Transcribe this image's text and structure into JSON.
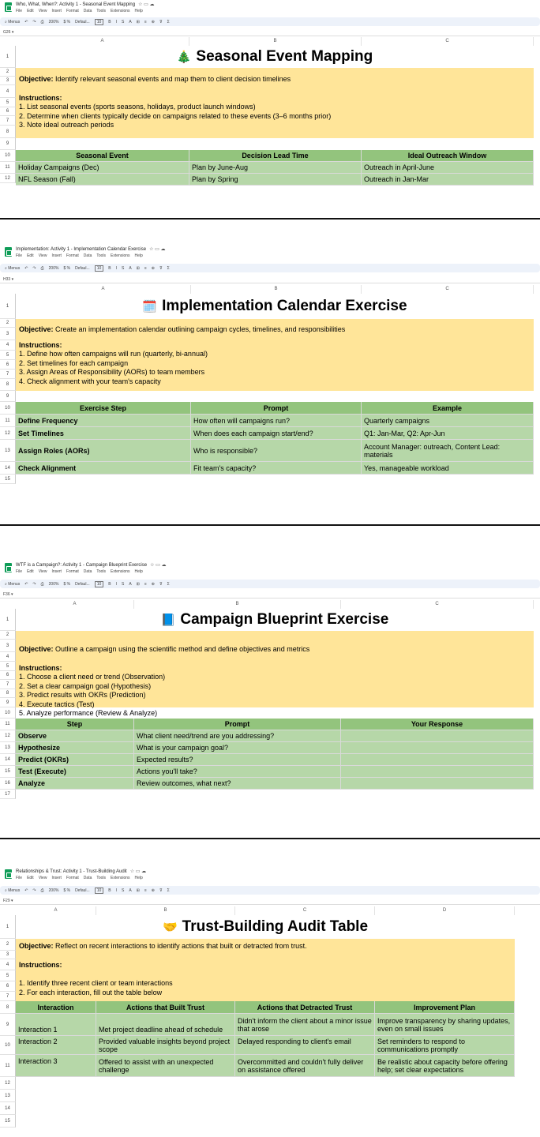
{
  "panels": [
    {
      "doc_title": "Who, What, When?: Activity 1 - Seasonal Event Mapping",
      "menus": [
        "File",
        "Edit",
        "View",
        "Insert",
        "Format",
        "Data",
        "Tools",
        "Extensions",
        "Help"
      ],
      "toolbar": {
        "menus": "Menus",
        "zoom": "200%",
        "font": "Defaul...",
        "size": "10"
      },
      "cell_ref": "G26",
      "columns": [
        "A",
        "B",
        "C"
      ],
      "rows": [
        "1",
        "2",
        "3",
        "4",
        "5",
        "6",
        "7",
        "8",
        "9",
        "10",
        "11",
        "12"
      ],
      "title_emoji": "🎄",
      "title": "Seasonal Event Mapping",
      "objective_label": "Objective:",
      "objective": " Identify relevant seasonal events and map them to client decision timelines",
      "instructions_label": "Instructions:",
      "instructions": [
        "1. List seasonal events (sports seasons, holidays, product launch windows)",
        "2. Determine when clients typically decide on campaigns related to these events (3–6 months prior)",
        "3. Note ideal outreach periods"
      ],
      "table_headers": [
        "Seasonal Event",
        "Decision Lead Time",
        "Ideal Outreach Window"
      ],
      "table_rows": [
        [
          "Holiday Campaigns (Dec)",
          "Plan by June-Aug",
          "Outreach in April-June"
        ],
        [
          "NFL Season (Fall)",
          "Plan by Spring",
          "Outreach in Jan-Mar"
        ]
      ]
    },
    {
      "doc_title": "Implementation: Activity 1 - Implementation Calendar Exercise",
      "menus": [
        "File",
        "Edit",
        "View",
        "Insert",
        "Format",
        "Data",
        "Tools",
        "Extensions",
        "Help"
      ],
      "toolbar": {
        "menus": "Menus",
        "zoom": "200%",
        "font": "Defaul...",
        "size": "10"
      },
      "cell_ref": "H33",
      "columns": [
        "A",
        "B",
        "C"
      ],
      "rows": [
        "1",
        "2",
        "3",
        "4",
        "5",
        "6",
        "7",
        "8",
        "9",
        "10",
        "11",
        "12",
        "13",
        "14",
        "15"
      ],
      "title_emoji": "🗓️",
      "title": "Implementation Calendar Exercise",
      "objective_label": "Objective:",
      "objective": " Create an implementation calendar outlining campaign cycles, timelines, and responsibilities",
      "instructions_label": "Instructions:",
      "instructions": [
        "1. Define how often campaigns will run (quarterly, bi-annual)",
        "2. Set timelines for each campaign",
        "3. Assign Areas of Responsibility (AORs) to team members",
        "4. Check alignment with your team's capacity"
      ],
      "table_headers": [
        "Exercise Step",
        "Prompt",
        "Example"
      ],
      "table_rows": [
        [
          "Define Frequency",
          "How often will campaigns run?",
          "Quarterly campaigns"
        ],
        [
          "Set Timelines",
          "When does each campaign start/end?",
          "Q1: Jan-Mar, Q2: Apr-Jun"
        ],
        [
          "Assign Roles (AORs)",
          "Who is responsible?",
          "Account Manager: outreach, Content Lead: materials"
        ],
        [
          "Check Alignment",
          "Fit team's capacity?",
          "Yes, manageable workload"
        ]
      ]
    },
    {
      "doc_title": "WTF is a Campaign?: Activity 1 - Campaign Blueprint Exercise",
      "menus": [
        "File",
        "Edit",
        "View",
        "Insert",
        "Format",
        "Data",
        "Tools",
        "Extensions",
        "Help"
      ],
      "toolbar": {
        "menus": "Menus",
        "zoom": "200%",
        "font": "Defaul...",
        "size": "10"
      },
      "cell_ref": "F36",
      "columns": [
        "A",
        "B",
        "C"
      ],
      "rows": [
        "1",
        "2",
        "3",
        "4",
        "5",
        "6",
        "7",
        "8",
        "9",
        "10",
        "11",
        "12",
        "13",
        "14",
        "15",
        "16",
        "17"
      ],
      "title_emoji": "📘",
      "title": "Campaign Blueprint Exercise",
      "objective_label": "Objective:",
      "objective": " Outline a campaign using the scientific method and define objectives and metrics",
      "instructions_label": "Instructions:",
      "instructions": [
        "1. Choose a client need or trend (Observation)",
        "2. Set a clear campaign goal (Hypothesis)",
        "3. Predict results with OKRs (Prediction)",
        "4. Execute tactics (Test)",
        "5. Analyze performance (Review & Analyze)"
      ],
      "table_headers": [
        "Step",
        "Prompt",
        "Your Response"
      ],
      "table_rows": [
        [
          "Observe",
          "What client need/trend are you addressing?",
          ""
        ],
        [
          "Hypothesize",
          "What is your campaign goal?",
          ""
        ],
        [
          "Predict (OKRs)",
          "Expected results?",
          ""
        ],
        [
          "Test (Execute)",
          "Actions you'll take?",
          ""
        ],
        [
          "Analyze",
          "Review outcomes, what next?",
          ""
        ]
      ]
    },
    {
      "doc_title": "Relationships & Trust: Activity 1 - Trust-Building Audit",
      "menus": [
        "File",
        "Edit",
        "View",
        "Insert",
        "Format",
        "Data",
        "Tools",
        "Extensions",
        "Help"
      ],
      "toolbar": {
        "menus": "Menus",
        "zoom": "200%",
        "font": "Defaul...",
        "size": "10"
      },
      "cell_ref": "F29",
      "columns": [
        "A",
        "B",
        "C",
        "D"
      ],
      "rows": [
        "1",
        "2",
        "3",
        "4",
        "5",
        "6",
        "7",
        "8",
        "9",
        "10",
        "11",
        "12",
        "13",
        "14",
        "15"
      ],
      "title_emoji": "🤝",
      "title": "Trust-Building Audit Table",
      "objective_label": "Objective:",
      "objective": " Reflect on recent interactions to identify actions that built or detracted from trust.",
      "instructions_label": "Instructions:",
      "instructions": [
        "1. Identify three recent client or team interactions",
        "2. For each interaction, fill out the table below"
      ],
      "table_headers": [
        "Interaction",
        "Actions that Built Trust",
        "Actions that Detracted Trust",
        "Improvement Plan"
      ],
      "table_rows": [
        [
          "Interaction 1",
          "Met project deadline ahead of schedule",
          "Didn't inform the client about a minor issue that arose",
          "Improve transparency by sharing updates, even on small issues"
        ],
        [
          "Interaction 2",
          "Provided valuable insights beyond project scope",
          "Delayed responding to client's email",
          "Set reminders to respond to communications promptly"
        ],
        [
          "Interaction 3",
          "Offered to assist with an unexpected challenge",
          "Overcommitted and couldn't fully deliver on assistance offered",
          "Be realistic about capacity before offering help; set clear expectations"
        ]
      ]
    }
  ]
}
